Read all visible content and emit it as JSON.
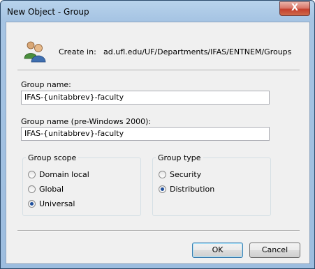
{
  "window": {
    "title": "New Object - Group",
    "close_glyph": "X"
  },
  "create_in": {
    "icon": "users-group-icon",
    "label": "Create in:",
    "path": "ad.ufl.edu/UF/Departments/IFAS/ENTNEM/Groups"
  },
  "group_name": {
    "label": "Group name:",
    "value": "IFAS-{unitabbrev}-faculty"
  },
  "group_name_pre2000": {
    "label": "Group name (pre-Windows 2000):",
    "value": "IFAS-{unitabbrev}-faculty"
  },
  "group_scope": {
    "title": "Group scope",
    "options": [
      {
        "label": "Domain local",
        "selected": false
      },
      {
        "label": "Global",
        "selected": false
      },
      {
        "label": "Universal",
        "selected": true
      }
    ]
  },
  "group_type": {
    "title": "Group type",
    "options": [
      {
        "label": "Security",
        "selected": false
      },
      {
        "label": "Distribution",
        "selected": true
      }
    ]
  },
  "buttons": {
    "ok": "OK",
    "cancel": "Cancel"
  },
  "colors": {
    "frame": "#a6c4e3",
    "close": "#c4402d",
    "client": "#f0f0f0"
  }
}
